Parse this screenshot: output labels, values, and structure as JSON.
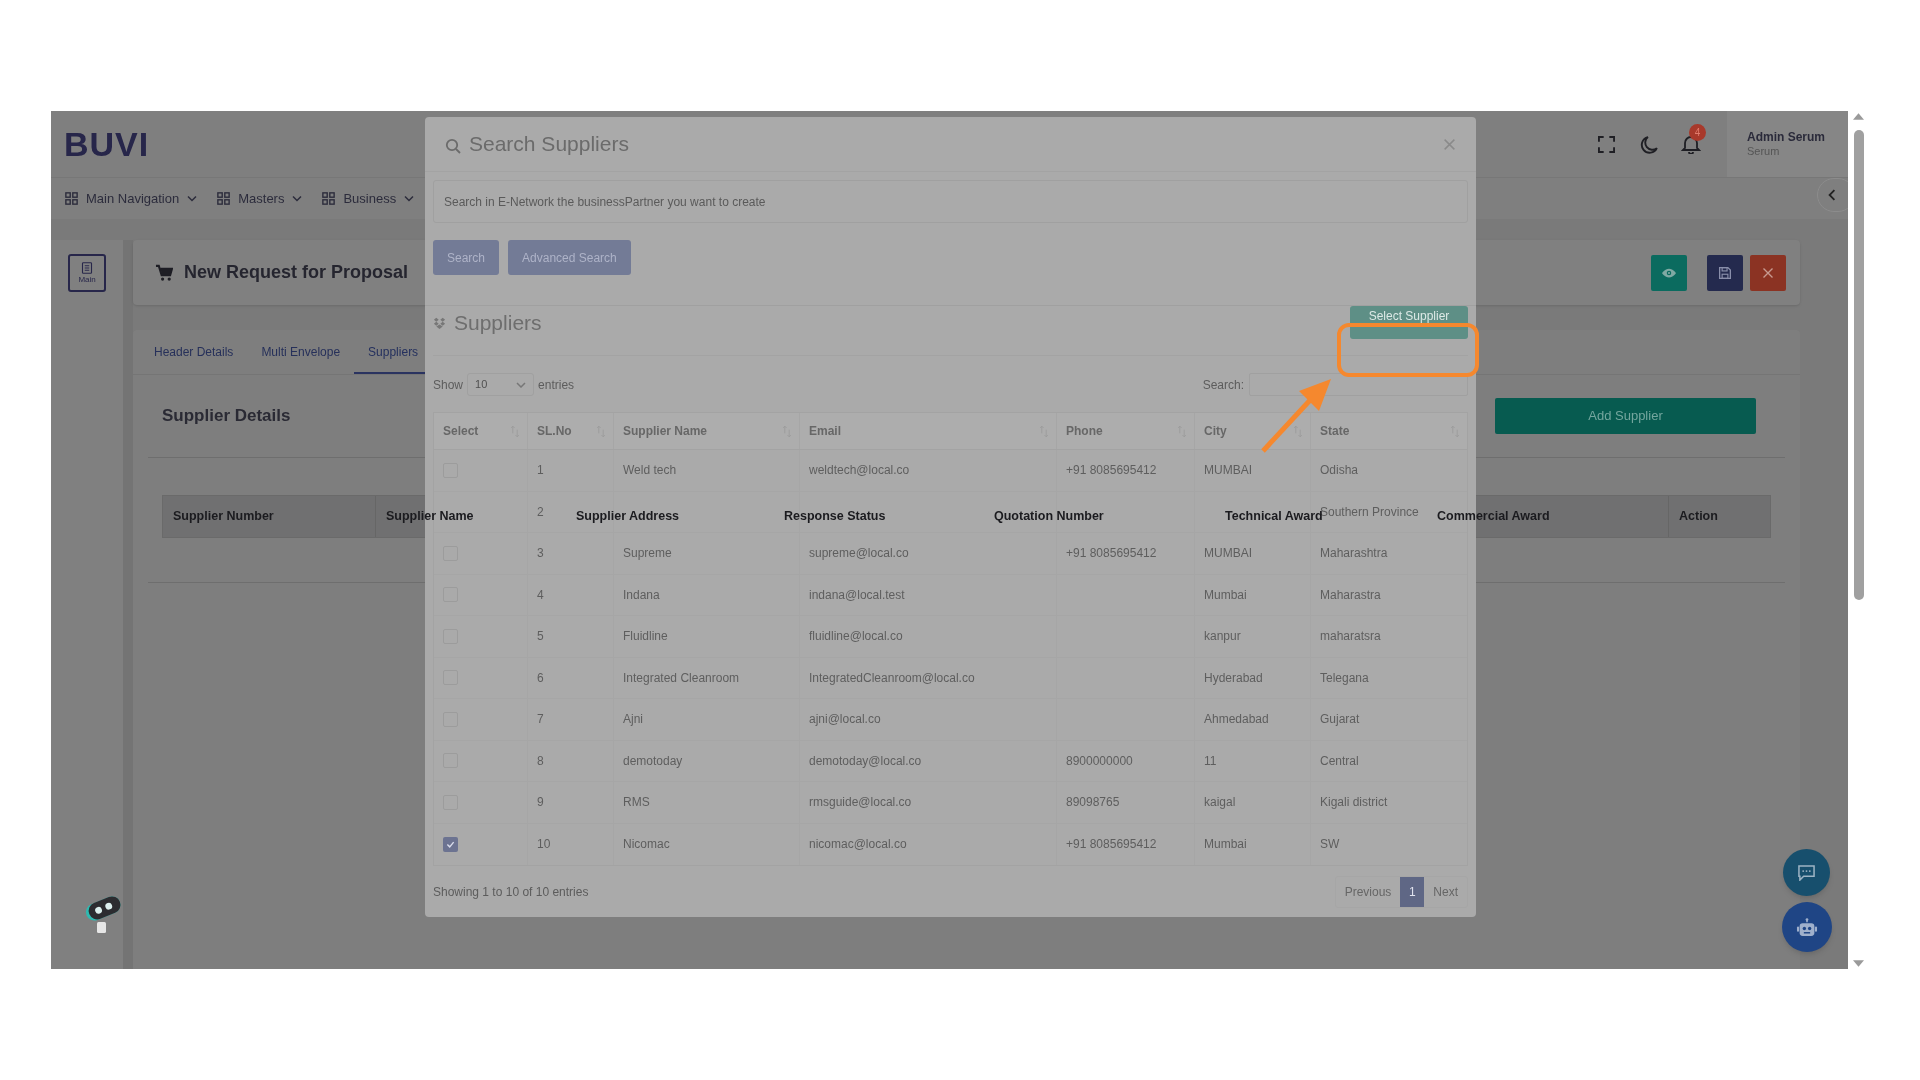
{
  "header": {
    "logo": "BUVI",
    "notification_count": "4",
    "user_name": "Admin Serum",
    "user_role": "Serum"
  },
  "nav_items": [
    {
      "label": "Main Navigation"
    },
    {
      "label": "Masters"
    },
    {
      "label": "Business"
    }
  ],
  "sidebar": {
    "items": [
      {
        "label": "Main"
      }
    ]
  },
  "page": {
    "title": "New Request for Proposal",
    "tabs": [
      {
        "label": "Header Details",
        "selected": false
      },
      {
        "label": "Multi Envelope",
        "selected": false
      },
      {
        "label": "Suppliers",
        "selected": true
      }
    ],
    "section_title": "Supplier Details",
    "add_button": "Add Supplier",
    "table_columns": [
      "Supplier Number",
      "Supplier Name",
      "Supplier Address",
      "Response Status",
      "Quotation Number",
      "Technical Award",
      "Commercial Award",
      "Action"
    ]
  },
  "modal": {
    "title": "Search Suppliers",
    "search_placeholder": "Search in E-Network the businessPartner you want to create",
    "buttons": [
      "Search",
      "Advanced Search"
    ],
    "list_title": "Suppliers",
    "select_button": "Select Supplier",
    "show_label": "Show",
    "page_length": "10",
    "entries_label": "entries",
    "filter_label": "Search:",
    "columns": [
      "Select",
      "SL.No",
      "Supplier Name",
      "Email",
      "Phone",
      "City",
      "State"
    ],
    "rows": [
      {
        "checked": false,
        "sl_no": "1",
        "supplier_name": "Weld tech",
        "email": "weldtech@local.co",
        "phone": "+91 8085695412",
        "city": "MUMBAI",
        "state": "Odisha"
      },
      {
        "sl_no": "2",
        "state": "Southern Province"
      },
      {
        "checked": false,
        "sl_no": "3",
        "supplier_name": "Supreme",
        "email": "supreme@local.co",
        "phone": "+91 8085695412",
        "city": "MUMBAI",
        "state": "Maharashtra"
      },
      {
        "checked": false,
        "sl_no": "4",
        "supplier_name": "Indana",
        "email": "indana@local.test",
        "city": "Mumbai",
        "state": "Maharastra"
      },
      {
        "checked": false,
        "sl_no": "5",
        "supplier_name": "Fluidline",
        "email": "fluidline@local.co",
        "city": "kanpur",
        "state": "maharatsra"
      },
      {
        "checked": false,
        "sl_no": "6",
        "supplier_name": "Integrated Cleanroom",
        "email": "IntegratedCleanroom@local.co",
        "city": "Hyderabad",
        "state": "Telegana"
      },
      {
        "checked": false,
        "sl_no": "7",
        "supplier_name": "Ajni",
        "email": "ajni@local.co",
        "city": "Ahmedabad",
        "state": "Gujarat"
      },
      {
        "checked": false,
        "sl_no": "8",
        "supplier_name": "demotoday",
        "email": "demotoday@local.co",
        "phone": "8900000000",
        "city": "11",
        "state": "Central"
      },
      {
        "checked": false,
        "sl_no": "9",
        "supplier_name": "RMS",
        "email": "rmsguide@local.co",
        "phone": "89098765",
        "city": "kaigal",
        "state": "Kigali district"
      },
      {
        "checked": true,
        "sl_no": "10",
        "supplier_name": "Nicomac",
        "email": "nicomac@local.co",
        "phone": "+91 8085695412",
        "city": "Mumbai",
        "state": "SW"
      }
    ],
    "info": "Showing 1 to 10 of 10 entries",
    "pagination": [
      {
        "label": "Previous",
        "selected": false,
        "disabled": true
      },
      {
        "label": "1",
        "selected": true,
        "disabled": false
      },
      {
        "label": "Next",
        "selected": false,
        "disabled": true
      }
    ]
  }
}
